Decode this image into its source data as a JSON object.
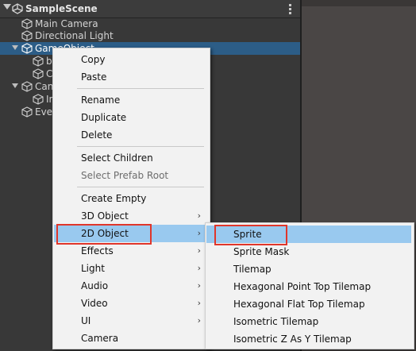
{
  "hierarchy": {
    "scene_name": "SampleScene",
    "rows": [
      {
        "label": "Main Camera"
      },
      {
        "label": "Directional Light"
      },
      {
        "label": "GameObject"
      },
      {
        "label": "bu"
      },
      {
        "label": "C"
      },
      {
        "label": "Can"
      },
      {
        "label": "Im"
      },
      {
        "label": "Eve"
      }
    ]
  },
  "context_menu": {
    "copy": "Copy",
    "paste": "Paste",
    "rename": "Rename",
    "duplicate": "Duplicate",
    "delete": "Delete",
    "select_children": "Select Children",
    "select_prefab_root": "Select Prefab Root",
    "create_empty": "Create Empty",
    "object_3d": "3D Object",
    "object_2d": "2D Object",
    "effects": "Effects",
    "light": "Light",
    "audio": "Audio",
    "video": "Video",
    "ui": "UI",
    "camera": "Camera",
    "submenu_arrow": "›"
  },
  "submenu_2d": {
    "sprite": "Sprite",
    "sprite_mask": "Sprite Mask",
    "tilemap": "Tilemap",
    "hex_point_top": "Hexagonal Point Top Tilemap",
    "hex_flat_top": "Hexagonal Flat Top Tilemap",
    "isometric": "Isometric Tilemap",
    "isometric_z_as_y": "Isometric Z As Y Tilemap"
  },
  "colors": {
    "panel_bg": "#383838",
    "selection": "#2c5d87",
    "menu_bg": "#f2f2f2",
    "menu_highlight": "#99c9ef",
    "annotation_red": "#e0362b"
  }
}
